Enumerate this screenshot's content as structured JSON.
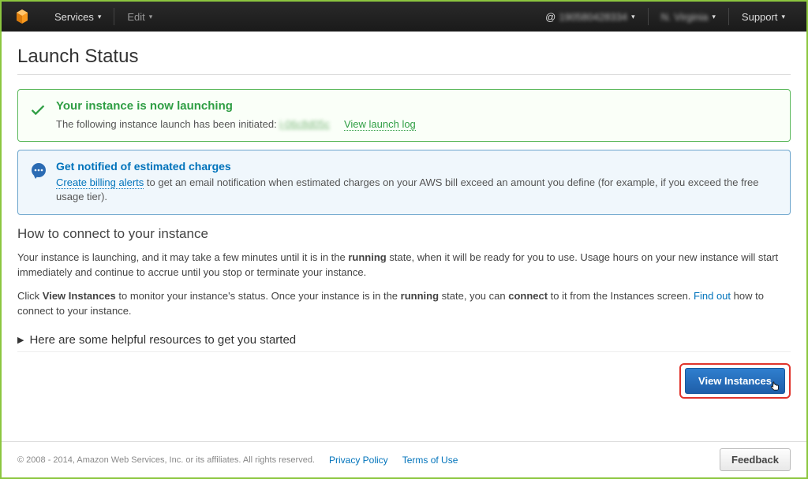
{
  "nav": {
    "services": "Services",
    "edit": "Edit",
    "account": "190580428334",
    "region": "N. Virginia",
    "support": "Support"
  },
  "page_title": "Launch Status",
  "success": {
    "title": "Your instance is now launching",
    "text_prefix": "The following instance launch has been initiated: ",
    "instance_id": "i-06c8d05c",
    "view_log": "View launch log"
  },
  "info": {
    "title": "Get notified of estimated charges",
    "create_alerts": "Create billing alerts",
    "text_suffix": " to get an email notification when estimated charges on your AWS bill exceed an amount you define (for example, if you exceed the free usage tier)."
  },
  "connect": {
    "heading": "How to connect to your instance",
    "p1_a": "Your instance is launching, and it may take a few minutes until it is in the ",
    "p1_running": "running",
    "p1_b": " state, when it will be ready for you to use. Usage hours on your new instance will start immediately and continue to accrue until you stop or terminate your instance.",
    "p2_a": "Click ",
    "p2_view": "View Instances",
    "p2_b": " to monitor your instance's status. Once your instance is in the ",
    "p2_running": "running",
    "p2_c": " state, you can ",
    "p2_connect": "connect",
    "p2_d": " to it from the Instances screen. ",
    "find_out": "Find out",
    "p2_e": " how to connect to your instance."
  },
  "resources_heading": "Here are some helpful resources to get you started",
  "view_instances_btn": "View Instances",
  "footer": {
    "copyright": "© 2008 - 2014, Amazon Web Services, Inc. or its affiliates. All rights reserved.",
    "privacy": "Privacy Policy",
    "terms": "Terms of Use",
    "feedback": "Feedback"
  }
}
